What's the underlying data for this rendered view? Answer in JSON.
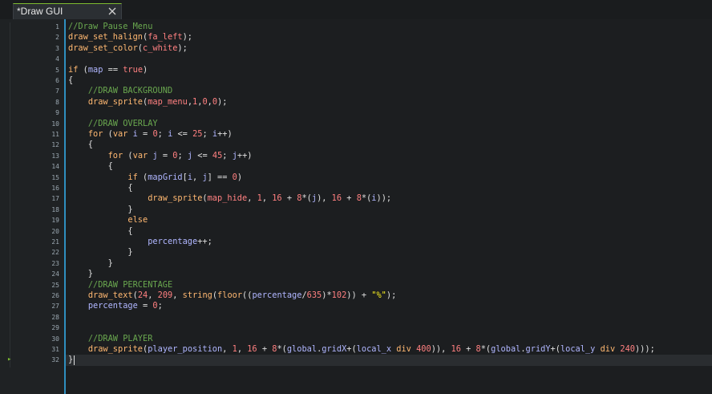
{
  "tab": {
    "title": "*Draw GUI",
    "close_icon": "close-icon"
  },
  "colors": {
    "accent": "#7dbb2f",
    "gutter_line": "#2f8fbf",
    "comment": "#6aa84f",
    "function": "#ffb871",
    "keyword": "#ffb871",
    "constant": "#ff8080",
    "variable": "#b0b6ff",
    "string": "#fcf320"
  },
  "editor": {
    "current_line": 32,
    "line_numbers": [
      "1",
      "2",
      "3",
      "4",
      "5",
      "6",
      "7",
      "8",
      "9",
      "10",
      "11",
      "12",
      "13",
      "14",
      "15",
      "16",
      "17",
      "18",
      "19",
      "20",
      "21",
      "22",
      "23",
      "24",
      "25",
      "26",
      "27",
      "28",
      "29",
      "30",
      "31",
      "32"
    ],
    "lines": [
      [
        [
          "cm",
          "//Draw Pause Menu"
        ]
      ],
      [
        [
          "fn",
          "draw_set_halign"
        ],
        [
          "op",
          "("
        ],
        [
          "const",
          "fa_left"
        ],
        [
          "op",
          ");"
        ]
      ],
      [
        [
          "fn",
          "draw_set_color"
        ],
        [
          "op",
          "("
        ],
        [
          "const",
          "c_white"
        ],
        [
          "op",
          ");"
        ]
      ],
      [],
      [
        [
          "kw",
          "if"
        ],
        [
          "op",
          " ("
        ],
        [
          "var",
          "map"
        ],
        [
          "op",
          " == "
        ],
        [
          "const",
          "true"
        ],
        [
          "op",
          ")"
        ]
      ],
      [
        [
          "op",
          "{"
        ]
      ],
      [
        [
          "op",
          "    "
        ],
        [
          "cm",
          "//DRAW BACKGROUND"
        ]
      ],
      [
        [
          "op",
          "    "
        ],
        [
          "fn",
          "draw_sprite"
        ],
        [
          "op",
          "("
        ],
        [
          "const",
          "map_menu"
        ],
        [
          "op",
          ","
        ],
        [
          "num",
          "1"
        ],
        [
          "op",
          ","
        ],
        [
          "num",
          "0"
        ],
        [
          "op",
          ","
        ],
        [
          "num",
          "0"
        ],
        [
          "op",
          ");"
        ]
      ],
      [],
      [
        [
          "op",
          "    "
        ],
        [
          "cm",
          "//DRAW OVERLAY"
        ]
      ],
      [
        [
          "op",
          "    "
        ],
        [
          "kw",
          "for"
        ],
        [
          "op",
          " ("
        ],
        [
          "kw2",
          "var"
        ],
        [
          "op",
          " "
        ],
        [
          "var",
          "i"
        ],
        [
          "op",
          " = "
        ],
        [
          "num",
          "0"
        ],
        [
          "op",
          "; "
        ],
        [
          "var",
          "i"
        ],
        [
          "op",
          " <= "
        ],
        [
          "num",
          "25"
        ],
        [
          "op",
          "; "
        ],
        [
          "var",
          "i"
        ],
        [
          "op",
          "++)"
        ]
      ],
      [
        [
          "op",
          "    {"
        ]
      ],
      [
        [
          "op",
          "        "
        ],
        [
          "kw",
          "for"
        ],
        [
          "op",
          " ("
        ],
        [
          "kw2",
          "var"
        ],
        [
          "op",
          " "
        ],
        [
          "var",
          "j"
        ],
        [
          "op",
          " = "
        ],
        [
          "num",
          "0"
        ],
        [
          "op",
          "; "
        ],
        [
          "var",
          "j"
        ],
        [
          "op",
          " <= "
        ],
        [
          "num",
          "45"
        ],
        [
          "op",
          "; "
        ],
        [
          "var",
          "j"
        ],
        [
          "op",
          "++)"
        ]
      ],
      [
        [
          "op",
          "        {"
        ]
      ],
      [
        [
          "op",
          "            "
        ],
        [
          "kw",
          "if"
        ],
        [
          "op",
          " ("
        ],
        [
          "var",
          "mapGrid"
        ],
        [
          "op",
          "["
        ],
        [
          "var",
          "i"
        ],
        [
          "op",
          ", "
        ],
        [
          "var",
          "j"
        ],
        [
          "op",
          "] == "
        ],
        [
          "num",
          "0"
        ],
        [
          "op",
          ")"
        ]
      ],
      [
        [
          "op",
          "            {"
        ]
      ],
      [
        [
          "op",
          "                "
        ],
        [
          "fn",
          "draw_sprite"
        ],
        [
          "op",
          "("
        ],
        [
          "const",
          "map_hide"
        ],
        [
          "op",
          ", "
        ],
        [
          "num",
          "1"
        ],
        [
          "op",
          ", "
        ],
        [
          "num",
          "16"
        ],
        [
          "op",
          " + "
        ],
        [
          "num",
          "8"
        ],
        [
          "op",
          "*("
        ],
        [
          "var",
          "j"
        ],
        [
          "op",
          "), "
        ],
        [
          "num",
          "16"
        ],
        [
          "op",
          " + "
        ],
        [
          "num",
          "8"
        ],
        [
          "op",
          "*("
        ],
        [
          "var",
          "i"
        ],
        [
          "op",
          "));"
        ]
      ],
      [
        [
          "op",
          "            }"
        ]
      ],
      [
        [
          "op",
          "            "
        ],
        [
          "kw",
          "else"
        ]
      ],
      [
        [
          "op",
          "            {"
        ]
      ],
      [
        [
          "op",
          "                "
        ],
        [
          "var",
          "percentage"
        ],
        [
          "op",
          "++;"
        ]
      ],
      [
        [
          "op",
          "            }"
        ]
      ],
      [
        [
          "op",
          "        }"
        ]
      ],
      [
        [
          "op",
          "    }"
        ]
      ],
      [
        [
          "op",
          "    "
        ],
        [
          "cm",
          "//DRAW PERCENTAGE"
        ]
      ],
      [
        [
          "op",
          "    "
        ],
        [
          "fn",
          "draw_text"
        ],
        [
          "op",
          "("
        ],
        [
          "num",
          "24"
        ],
        [
          "op",
          ", "
        ],
        [
          "num",
          "209"
        ],
        [
          "op",
          ", "
        ],
        [
          "fn",
          "string"
        ],
        [
          "op",
          "("
        ],
        [
          "fn",
          "floor"
        ],
        [
          "op",
          "(("
        ],
        [
          "var",
          "percentage"
        ],
        [
          "op",
          "/"
        ],
        [
          "num",
          "635"
        ],
        [
          "op",
          ")*"
        ],
        [
          "num",
          "102"
        ],
        [
          "op",
          ")) + "
        ],
        [
          "str",
          "\"%\""
        ],
        [
          "op",
          ");"
        ]
      ],
      [
        [
          "op",
          "    "
        ],
        [
          "var",
          "percentage"
        ],
        [
          "op",
          " = "
        ],
        [
          "num",
          "0"
        ],
        [
          "op",
          ";"
        ]
      ],
      [],
      [],
      [
        [
          "op",
          "    "
        ],
        [
          "cm",
          "//DRAW PLAYER"
        ]
      ],
      [
        [
          "op",
          "    "
        ],
        [
          "fn",
          "draw_sprite"
        ],
        [
          "op",
          "("
        ],
        [
          "var",
          "player_position"
        ],
        [
          "op",
          ", "
        ],
        [
          "num",
          "1"
        ],
        [
          "op",
          ", "
        ],
        [
          "num",
          "16"
        ],
        [
          "op",
          " + "
        ],
        [
          "num",
          "8"
        ],
        [
          "op",
          "*("
        ],
        [
          "var",
          "global"
        ],
        [
          "op",
          "."
        ],
        [
          "var",
          "gridX"
        ],
        [
          "op",
          "+("
        ],
        [
          "var",
          "local_x"
        ],
        [
          "op",
          " "
        ],
        [
          "kw",
          "div"
        ],
        [
          "op",
          " "
        ],
        [
          "num",
          "400"
        ],
        [
          "op",
          ")), "
        ],
        [
          "num",
          "16"
        ],
        [
          "op",
          " + "
        ],
        [
          "num",
          "8"
        ],
        [
          "op",
          "*("
        ],
        [
          "var",
          "global"
        ],
        [
          "op",
          "."
        ],
        [
          "var",
          "gridY"
        ],
        [
          "op",
          "+("
        ],
        [
          "var",
          "local_y"
        ],
        [
          "op",
          " "
        ],
        [
          "kw",
          "div"
        ],
        [
          "op",
          " "
        ],
        [
          "num",
          "240"
        ],
        [
          "op",
          ")));"
        ]
      ],
      [
        [
          "op",
          "}"
        ]
      ]
    ]
  }
}
